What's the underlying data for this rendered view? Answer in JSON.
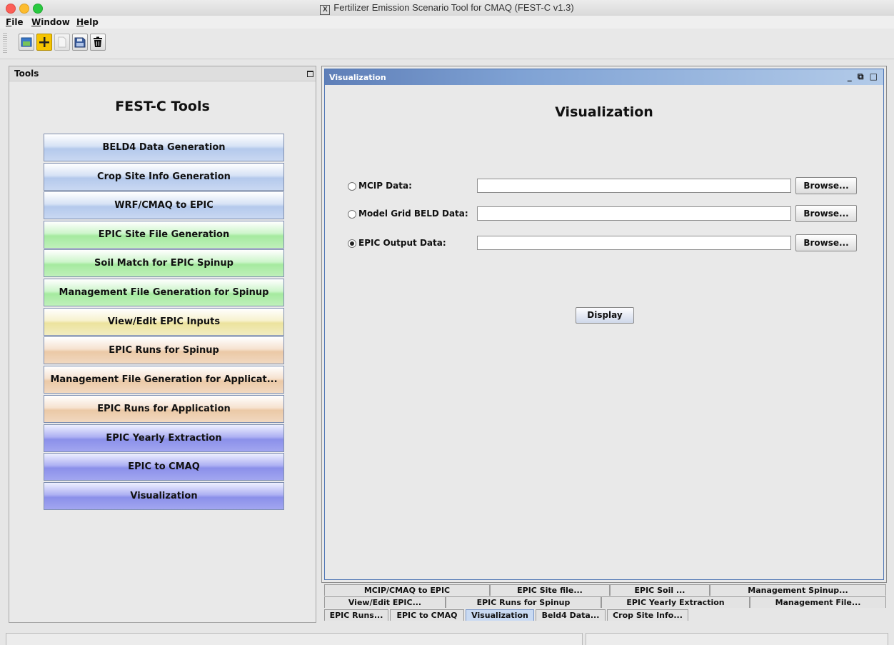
{
  "window": {
    "title": "Fertilizer Emission Scenario Tool for CMAQ (FEST-C v1.3)",
    "x_icon": "X"
  },
  "menu": [
    {
      "label": "File",
      "underline": "F",
      "rest": "ile"
    },
    {
      "label": "Window",
      "underline": "W",
      "rest": "indow"
    },
    {
      "label": "Help",
      "underline": "H",
      "rest": "elp"
    }
  ],
  "toolbar": {
    "icons": [
      "open-folder-icon",
      "add-plus-icon",
      "new-file-icon",
      "save-floppy-icon",
      "trash-icon"
    ]
  },
  "tools_panel": {
    "header": "Tools",
    "heading": "FEST-C Tools",
    "buttons": [
      {
        "label": "BELD4 Data Generation",
        "color": "#c9d8f2"
      },
      {
        "label": "Crop Site Info Generation",
        "color": "#c9d8f2"
      },
      {
        "label": "WRF/CMAQ to EPIC",
        "color": "#c9d8f2"
      },
      {
        "label": "EPIC Site File Generation",
        "color": "#bff0ba"
      },
      {
        "label": "Soil Match for EPIC Spinup",
        "color": "#bff0ba"
      },
      {
        "label": "Management File Generation for Spinup",
        "color": "#bff0ba"
      },
      {
        "label": "View/Edit EPIC Inputs",
        "color": "#f2ecc0"
      },
      {
        "label": "EPIC Runs for Spinup",
        "color": "#f1d8c0"
      },
      {
        "label": "Management File Generation for Applicat...",
        "color": "#f1d8c0"
      },
      {
        "label": "EPIC Runs for Application",
        "color": "#f1d8c0"
      },
      {
        "label": "EPIC Yearly Extraction",
        "color": "#a2a6f0"
      },
      {
        "label": "EPIC to CMAQ",
        "color": "#a2a6f0"
      },
      {
        "label": "Visualization",
        "color": "#a2a6f0"
      }
    ]
  },
  "visualization": {
    "frame_title": "Visualization",
    "frame_controls": "_ ⧉ □",
    "heading": "Visualization",
    "rows": [
      {
        "label": "MCIP Data:",
        "value": "",
        "selected": false,
        "browse": "Browse..."
      },
      {
        "label": "Model Grid BELD Data:",
        "value": "",
        "selected": false,
        "browse": "Browse..."
      },
      {
        "label": "EPIC Output Data:",
        "value": "",
        "selected": true,
        "browse": "Browse..."
      }
    ],
    "display_button": "Display"
  },
  "tabs": {
    "row1": [
      "MCIP/CMAQ to EPIC",
      "EPIC Site file...",
      "EPIC Soil ...",
      "Management Spinup..."
    ],
    "row2": [
      "View/Edit EPIC...",
      "EPIC Runs for Spinup",
      "EPIC Yearly Extraction",
      "Management File..."
    ],
    "row3": [
      "EPIC Runs...",
      "EPIC to CMAQ",
      "Visualization",
      "Beld4 Data...",
      "Crop Site Info..."
    ],
    "active": "Visualization"
  }
}
